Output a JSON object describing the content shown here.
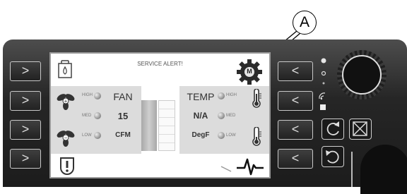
{
  "callout": {
    "label": "A"
  },
  "screen": {
    "alert": "SERVICE ALERT!",
    "fan": {
      "title": "FAN",
      "value": "15",
      "unit": "CFM",
      "levels": [
        "HIGH",
        "MED",
        "LOW"
      ]
    },
    "temp": {
      "title": "TEMP",
      "value": "N/A",
      "unit": "DegF",
      "levels": [
        "HIGH",
        "MED",
        "LOW"
      ]
    },
    "gear_badge": "M"
  },
  "left_buttons": [
    ">",
    ">",
    ">",
    ">"
  ],
  "right_buttons": [
    "<",
    "<",
    "<",
    "<"
  ],
  "icons": {
    "water_filter": "water-filter-icon",
    "gear": "gear-icon",
    "warning": "warning-icon",
    "pulse": "pulse-icon",
    "fan": "fan-icon",
    "thermometer": "thermometer-icon",
    "refresh": "refresh-icon",
    "close": "close-icon",
    "undo": "undo-icon",
    "wifi": "wifi-icon"
  },
  "colors": {
    "panel": "#262626",
    "screen": "#ffffff",
    "band": "#dcdcdc"
  }
}
